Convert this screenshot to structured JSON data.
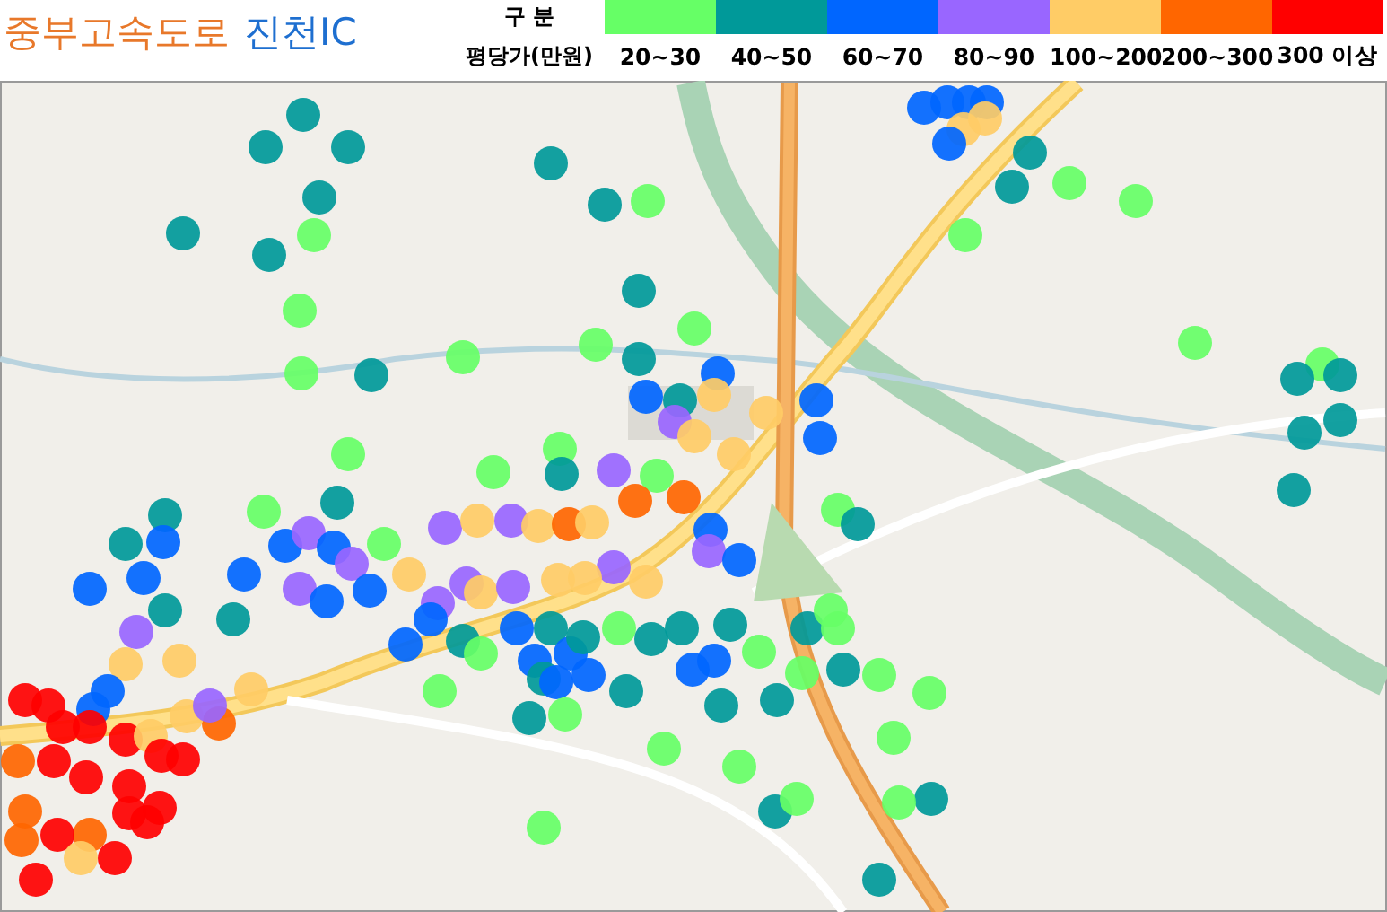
{
  "title": {
    "road": "중부고속도로",
    "exit": "진천IC"
  },
  "legend": {
    "header": "구 분",
    "unit": "평당가(만원)",
    "items": [
      {
        "label": "20~30",
        "color": "#66ff66"
      },
      {
        "label": "40~50",
        "color": "#009999"
      },
      {
        "label": "60~70",
        "color": "#0066ff"
      },
      {
        "label": "80~90",
        "color": "#9966ff"
      },
      {
        "label": "100~200",
        "color": "#ffcc66"
      },
      {
        "label": "200~300",
        "color": "#ff6600"
      },
      {
        "label": "300 이상",
        "color": "#ff0000"
      }
    ]
  }
}
